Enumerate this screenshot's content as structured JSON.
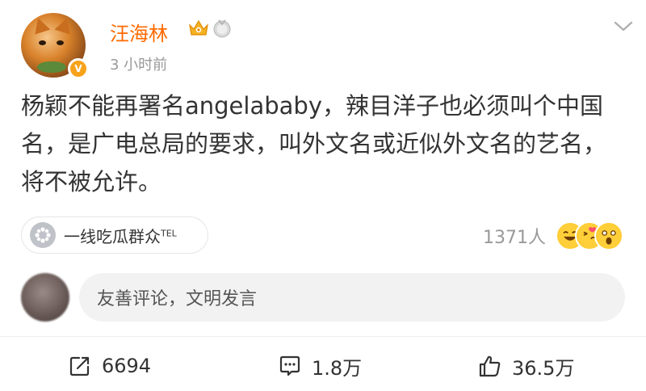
{
  "post": {
    "author": {
      "username": "汪海林",
      "avatar_icon": "cat-avatar",
      "verify_badge_icon": "verified-v-icon",
      "badges": [
        "crown-vip-icon",
        "medal-icon"
      ],
      "accent_color": "#ff6a00"
    },
    "timestamp": "3 小时前",
    "content": "杨颖不能再署名angelababy，辣目洋子也必须叫个中国名，是广电总局的要求，叫外文名或近似外文名的艺名，将不被允许。",
    "topic": {
      "label": "一线吃瓜群众",
      "suffix": "TEL",
      "icon": "topic-icon"
    },
    "reactions": {
      "count": "1371人",
      "emojis": [
        "laugh-emoji",
        "heart-kiss-emoji",
        "shocked-emoji"
      ]
    }
  },
  "comment_box": {
    "placeholder": "友善评论，文明发言"
  },
  "actions": {
    "repost": {
      "count": "6694",
      "icon": "repost-icon"
    },
    "comment": {
      "count": "1.8万",
      "icon": "comment-icon"
    },
    "like": {
      "count": "36.5万",
      "icon": "thumbs-up-icon"
    }
  }
}
